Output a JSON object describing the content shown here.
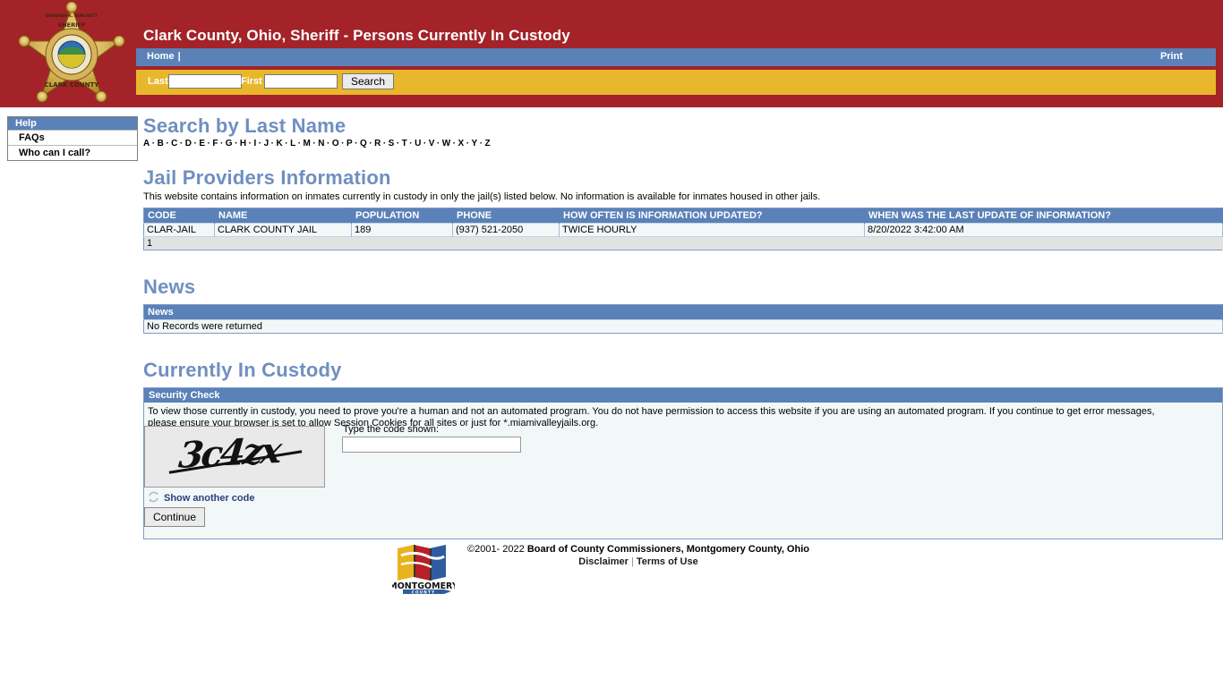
{
  "header": {
    "title": "Clark County, Ohio, Sheriff - Persons Currently In Custody",
    "badge": {
      "top_text": "DEBORAH K. BURCHETT",
      "mid_text": "SHERIFF",
      "bottom_text": "CLARK COUNTY",
      "icon": "sheriff-star-badge-icon"
    },
    "colors": {
      "header_red": "#a32328",
      "nav_blue": "#5a81b8",
      "search_gold": "#e8b72c",
      "heading_blue": "#6f8fc0"
    }
  },
  "nav": {
    "home_label": "Home",
    "separator": "|",
    "print_label": "Print"
  },
  "search": {
    "last_label": "Last",
    "last_value": "",
    "last_placeholder": "",
    "first_label": "First",
    "first_value": "",
    "first_placeholder": "",
    "button_label": "Search"
  },
  "sidebar": {
    "header": "Help",
    "items": [
      {
        "label": "FAQs"
      },
      {
        "label": "Who can I call?"
      }
    ]
  },
  "search_by_last_name": {
    "heading": "Search by Last Name",
    "letters": [
      "A",
      "B",
      "C",
      "D",
      "E",
      "F",
      "G",
      "H",
      "I",
      "J",
      "K",
      "L",
      "M",
      "N",
      "O",
      "P",
      "Q",
      "R",
      "S",
      "T",
      "U",
      "V",
      "W",
      "X",
      "Y",
      "Z"
    ]
  },
  "jail_providers": {
    "heading": "Jail Providers Information",
    "lead": "This website contains information on inmates currently in custody in only the jail(s) listed below. No information is available for inmates housed in other jails.",
    "columns": [
      "CODE",
      "NAME",
      "POPULATION",
      "PHONE",
      "HOW OFTEN IS INFORMATION UPDATED?",
      "WHEN WAS THE LAST UPDATE OF INFORMATION?"
    ],
    "rows": [
      {
        "code": "CLAR-JAIL",
        "name": "CLARK COUNTY JAIL",
        "population": "189",
        "phone": "(937) 521-2050",
        "update_frequency": "TWICE HOURLY",
        "last_update": "8/20/2022 3:42:00 AM"
      }
    ],
    "page_number": "1"
  },
  "news": {
    "heading": "News",
    "column": "News",
    "empty_message": "No Records were returned"
  },
  "custody": {
    "heading": "Currently In Custody",
    "panel_title": "Security Check",
    "body_line1": "To view those currently in custody, you need to prove you're a human and not an automated program. You do not have permission to access this website if you are using an automated program. If you continue to get error messages,",
    "body_line2": "please ensure your browser is set to allow Session Cookies for all sites or just for *.miamivalleyjails.org.",
    "captcha_code": "3c4zx",
    "code_label": "Type the code shown:",
    "code_value": "",
    "code_placeholder": "",
    "show_another_label": "Show another code",
    "show_another_icon": "refresh-icon",
    "continue_label": "Continue"
  },
  "footer": {
    "logo_alt": "montgomery-county-logo-icon",
    "logo_name_top": "MONTGOMERY",
    "logo_name_bottom": "C O U N T Y",
    "copyright_prefix": "©2001- 2022 ",
    "copyright_owner": "Board of County Commissioners, Montgomery County, Ohio",
    "disclaimer_label": "Disclaimer",
    "link_separator": "|",
    "terms_label": "Terms of Use"
  }
}
